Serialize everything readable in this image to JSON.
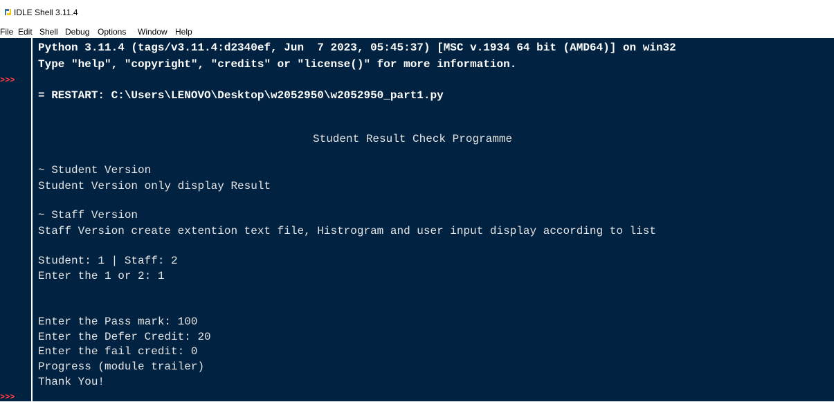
{
  "window": {
    "title": "IDLE Shell 3.11.4"
  },
  "menu": [
    "File",
    "Edit",
    "Shell",
    "Debug",
    "Options",
    "Window",
    "Help"
  ],
  "prompt": ">>>",
  "lines": {
    "banner1": "Python 3.11.4 (tags/v3.11.4:d2340ef, Jun  7 2023, 05:45:37) [MSC v.1934 64 bit (AMD64)] on win32",
    "banner2": "Type \"help\", \"copyright\", \"credits\" or \"license()\" for more information.",
    "restart": "= RESTART: C:\\Users\\LENOVO\\Desktop\\w2052950\\w2052950_part1.py",
    "program_title": "Student Result Check Programme",
    "student_heading": "~ Student Version",
    "student_desc": "Student Version only display Result",
    "staff_heading": "~ Staff Version",
    "staff_desc": "Staff Version create extention text file, Histrogram and user input display according to list",
    "choice_menu": "Student: 1 | Staff: 2",
    "choice_input": "Enter the 1 or 2: 1",
    "pass_mark": "Enter the Pass mark: 100",
    "defer_credit": "Enter the Defer Credit: 20",
    "fail_credit": "Enter the fail credit: 0",
    "progress": "Progress (module trailer)",
    "thanks": "Thank You!"
  },
  "colors": {
    "shell_bg": "#012240",
    "prompt": "#ff3b3b",
    "text": "#ffffff"
  },
  "icons": {
    "app": "python-idle-icon"
  }
}
